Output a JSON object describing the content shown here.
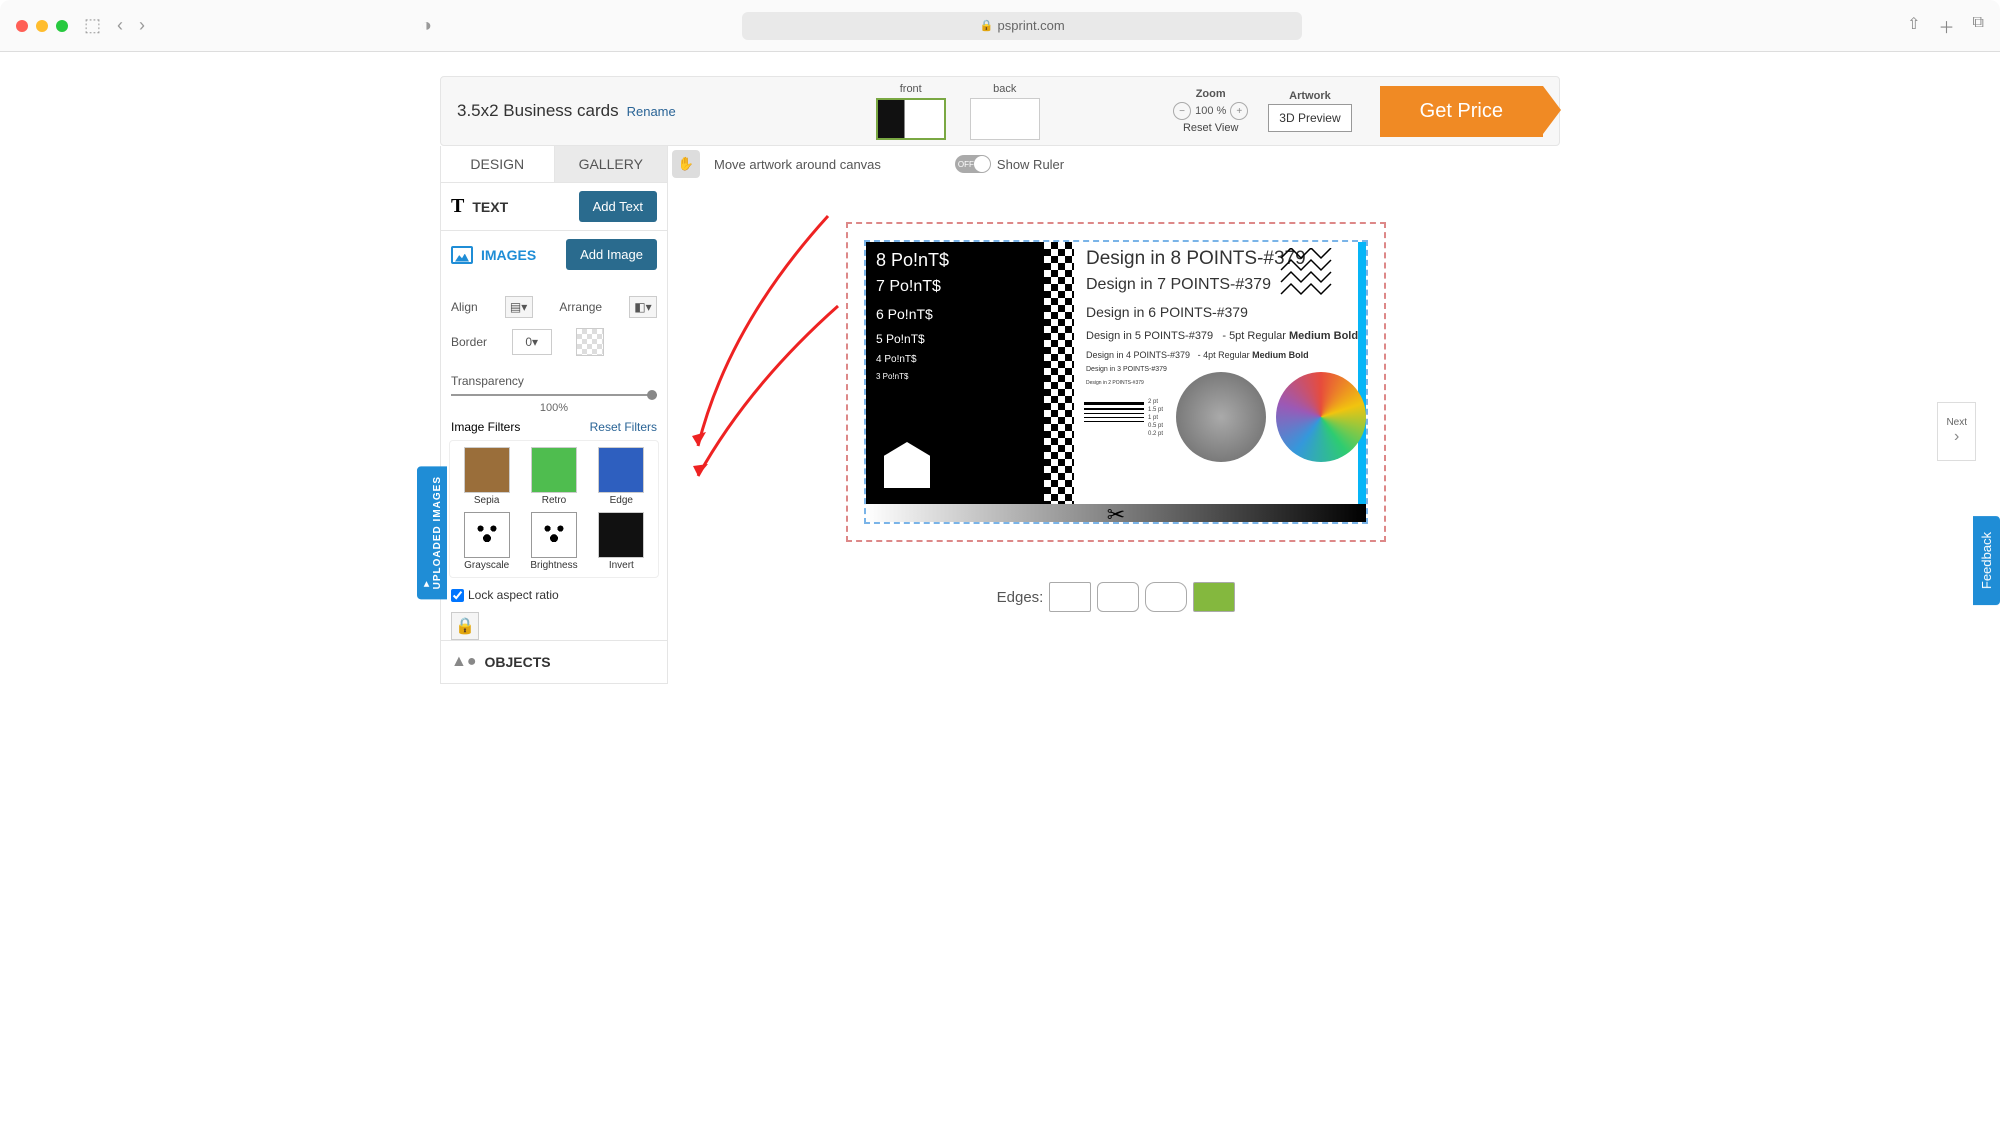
{
  "browser": {
    "url": "psprint.com"
  },
  "header": {
    "title": "3.5x2 Business cards",
    "rename": "Rename",
    "thumbs": {
      "front": "front",
      "back": "back"
    },
    "zoom": {
      "label": "Zoom",
      "value": "100 %",
      "reset": "Reset View"
    },
    "artwork": {
      "label": "Artwork",
      "button": "3D Preview"
    },
    "cta": "Get Price"
  },
  "sidebar": {
    "tabs": {
      "design": "DESIGN",
      "gallery": "GALLERY"
    },
    "text": {
      "label": "TEXT",
      "add": "Add Text"
    },
    "images": {
      "label": "IMAGES",
      "add": "Add Image"
    },
    "align": "Align",
    "arrange": "Arrange",
    "border": {
      "label": "Border",
      "value": "0"
    },
    "transparency": {
      "label": "Transparency",
      "value": "100%"
    },
    "filters": {
      "label": "Image Filters",
      "reset": "Reset Filters",
      "items": [
        "Sepia",
        "Retro",
        "Edge",
        "Grayscale",
        "Brightness",
        "Invert"
      ]
    },
    "lock": "Lock aspect ratio",
    "objects": "OBJECTS",
    "uploaded": "UPLOADED IMAGES"
  },
  "canvas": {
    "move": "Move artwork around canvas",
    "ruler": "Show Ruler",
    "toggle": "OFF",
    "content": {
      "l1": "8 Po!nT$",
      "l2": "7 Po!nT$",
      "l3": "6 Po!nT$",
      "l4": "5 Po!nT$",
      "l5": "4 Po!nT$",
      "l6": "3 Po!nT$",
      "r1": "Design in 8 POINTS-#379",
      "r2": "Design in 7 POINTS-#379",
      "r3": "Design in 6 POINTS-#379",
      "r4a": "Design in 5 POINTS-#379",
      "r4b": "- 5pt Regular",
      "r4c": "Medium",
      "r4d": "Bold",
      "r5a": "Design in 4 POINTS-#379",
      "r5b": "- 4pt Regular",
      "r5c": "Medium",
      "r5d": "Bold",
      "r6": "Design in 3 POINTS-#379",
      "r7": "Design in 2 POINTS-#379",
      "pts": [
        "2 pt",
        "1.5 pt",
        "1 pt",
        "0.5 pt",
        "0.2 pt"
      ]
    },
    "edges": "Edges:"
  },
  "next": "Next",
  "feedback": "Feedback"
}
